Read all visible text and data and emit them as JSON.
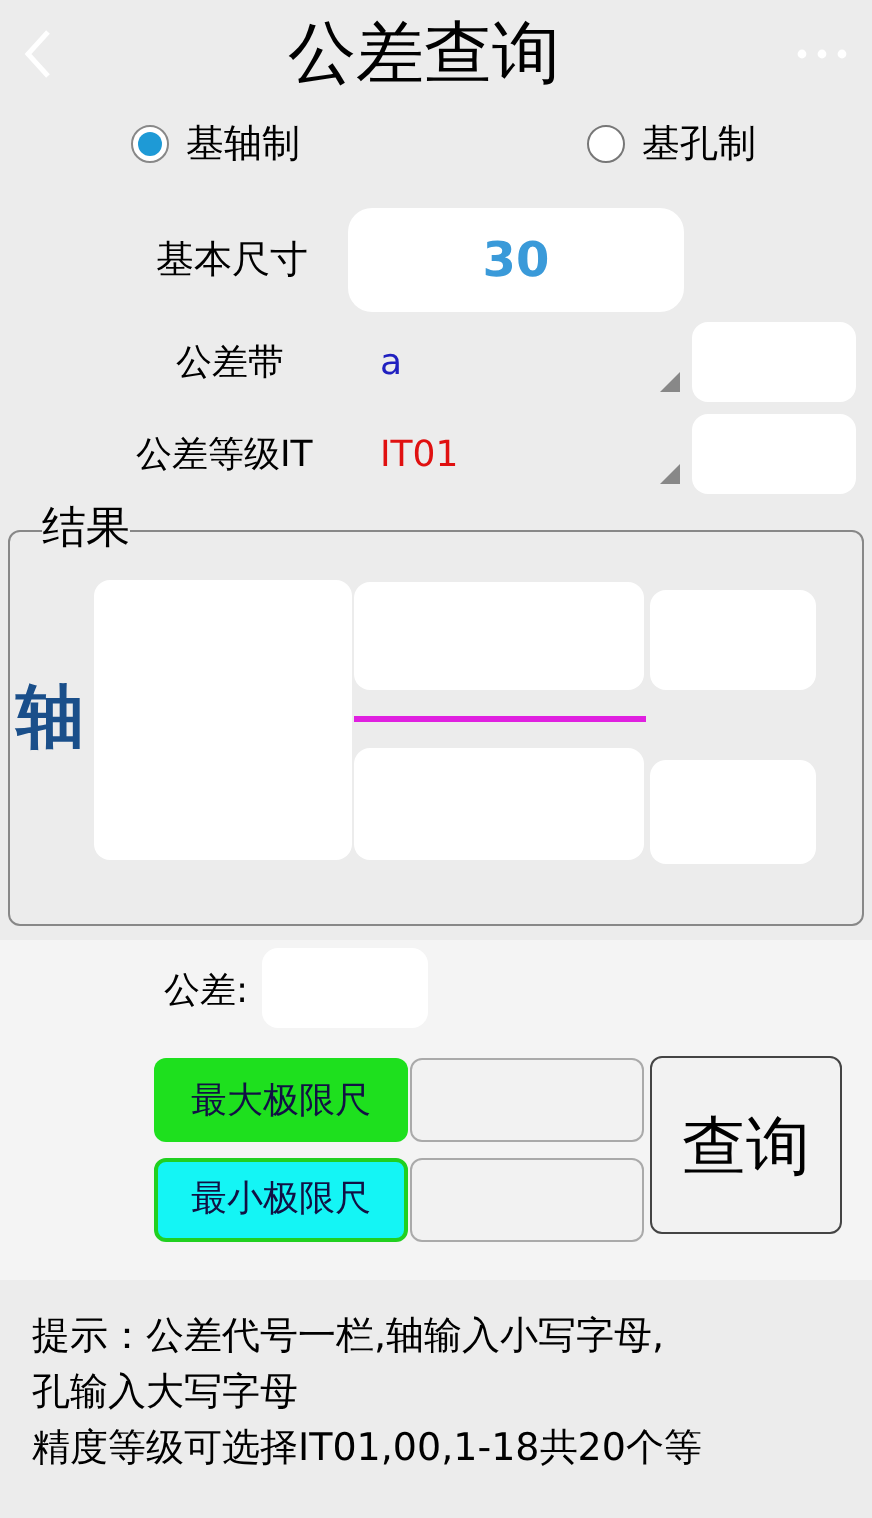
{
  "title": "公差查询",
  "mode_options": [
    {
      "label": "基轴制",
      "selected": true
    },
    {
      "label": "基孔制",
      "selected": false
    }
  ],
  "basic_size": {
    "label": "基本尺寸",
    "value": "30"
  },
  "tolerance_band": {
    "label": "公差带",
    "value": "a"
  },
  "grade": {
    "label": "公差等级IT",
    "value": "IT01"
  },
  "result": {
    "title": "结果",
    "part": "轴"
  },
  "tolerance": {
    "label": "公差:"
  },
  "max_limit": {
    "label": "最大极限尺"
  },
  "min_limit": {
    "label": "最小极限尺"
  },
  "query_button": "查询",
  "hint_lines": [
    "提示：公差代号一栏,轴输入小写字母,",
    "孔输入大写字母",
    "精度等级可选择IT01,00,1-18共20个等"
  ]
}
